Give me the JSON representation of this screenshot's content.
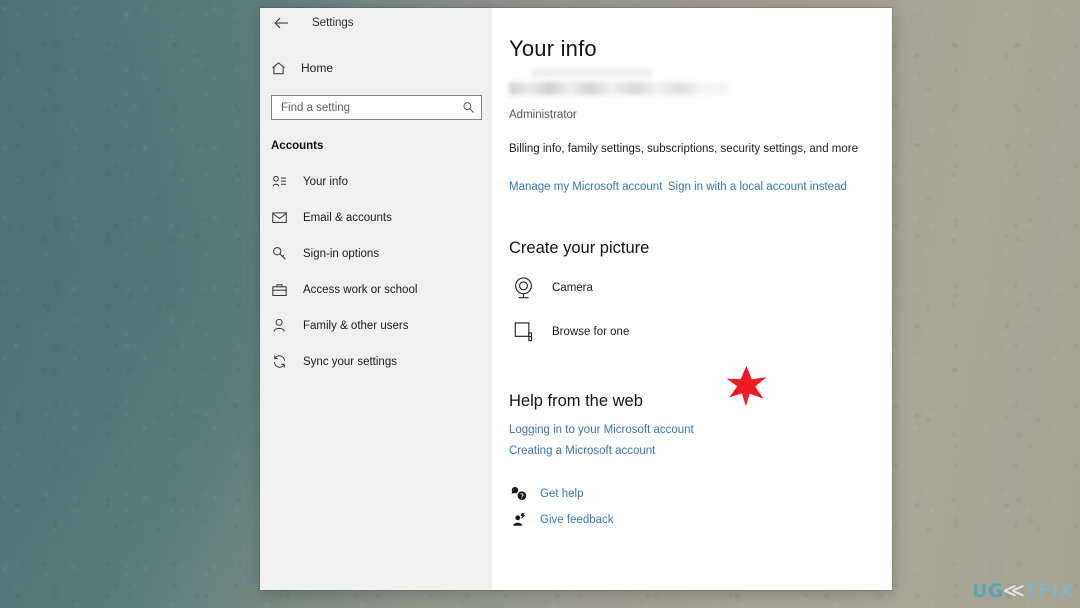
{
  "window": {
    "title": "Settings",
    "back_icon": "back-arrow-icon"
  },
  "nav": {
    "home": {
      "label": "Home",
      "icon": "home-icon"
    },
    "search": {
      "value": "",
      "placeholder": "Find a setting",
      "icon": "search-icon"
    },
    "section_heading": "Accounts",
    "items": [
      {
        "label": "Your info",
        "icon": "user-info-icon"
      },
      {
        "label": "Email & accounts",
        "icon": "envelope-icon"
      },
      {
        "label": "Sign-in options",
        "icon": "key-icon"
      },
      {
        "label": "Access work or school",
        "icon": "briefcase-icon"
      },
      {
        "label": "Family & other users",
        "icon": "person-icon"
      },
      {
        "label": "Sync your settings",
        "icon": "sync-icon"
      }
    ]
  },
  "content": {
    "page_title": "Your info",
    "account_name_redacted": "",
    "account_role": "Administrator",
    "billing_text": "Billing info, family settings, subscriptions, security settings, and more",
    "manage_account_link": "Manage my Microsoft account",
    "local_account_link": "Sign in with a local account instead",
    "create_picture_title": "Create your picture",
    "picture_options": [
      {
        "label": "Camera",
        "icon": "webcam-icon"
      },
      {
        "label": "Browse for one",
        "icon": "browse-folder-icon"
      }
    ],
    "help_web_title": "Help from the web",
    "help_links": [
      "Logging in to your Microsoft account",
      "Creating a Microsoft account"
    ],
    "footer_links": [
      {
        "label": "Get help",
        "icon": "help-bubble-icon"
      },
      {
        "label": "Give feedback",
        "icon": "feedback-person-icon"
      }
    ]
  },
  "annotation": {
    "star_marker": "red-star-marker",
    "star_color": "#ee1b24"
  },
  "watermark": {
    "part_a": "UG",
    "arrow": "≪",
    "part_b": "TFIX"
  },
  "colors": {
    "link": "#3b77b0",
    "nav_background": "#f0f0f0",
    "content_background": "#ffffff",
    "star": "#ee1b24",
    "watermark_primary": "#39a8c4",
    "watermark_secondary": "#7fb8c9"
  }
}
